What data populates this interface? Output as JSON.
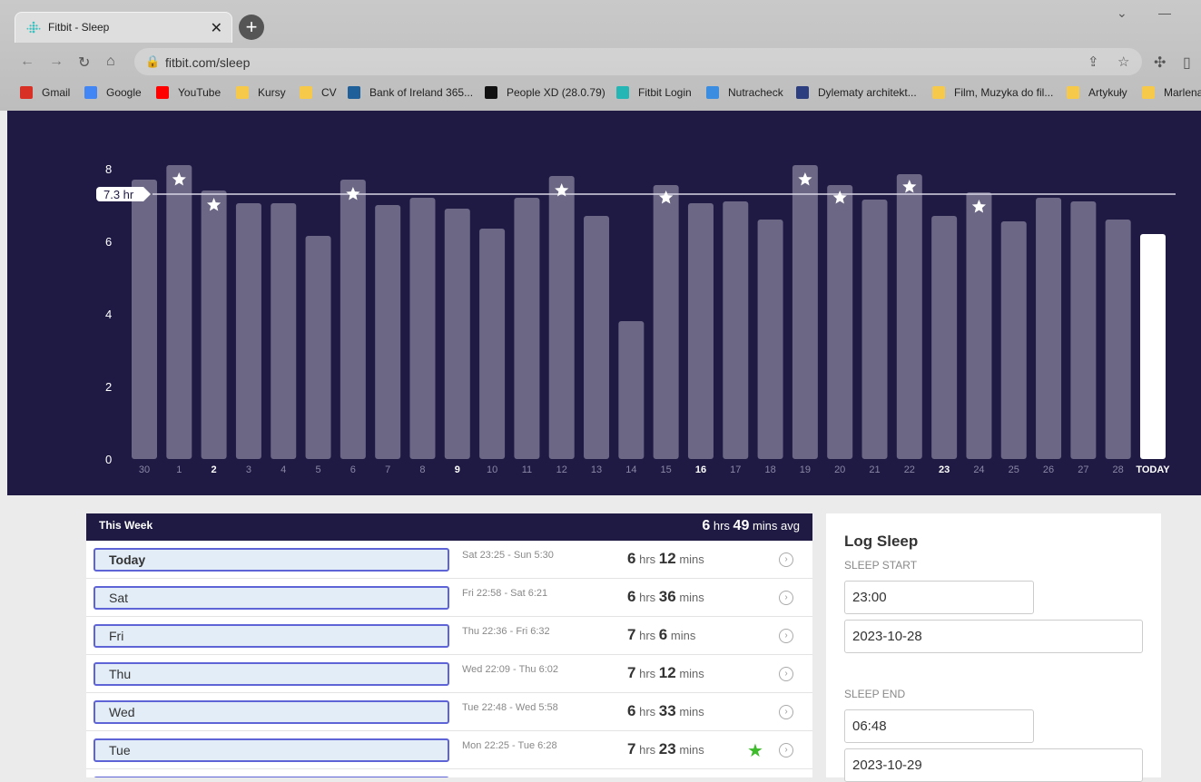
{
  "browser": {
    "tab_title": "Fitbit - Sleep",
    "url": "fitbit.com/sleep",
    "bookmarks": [
      {
        "label": "Gmail",
        "color": "#d93025"
      },
      {
        "label": "Google",
        "color": "#4285f4"
      },
      {
        "label": "YouTube",
        "color": "#ff0000"
      },
      {
        "label": "Kursy",
        "color": "#f6c94b"
      },
      {
        "label": "CV",
        "color": "#f6c94b"
      },
      {
        "label": "Bank of Ireland 365...",
        "color": "#1f5f9a"
      },
      {
        "label": "People XD (28.0.79)",
        "color": "#111111"
      },
      {
        "label": "Fitbit Login",
        "color": "#24b5b5"
      },
      {
        "label": "Nutracheck",
        "color": "#3a8de0"
      },
      {
        "label": "Dylematy architekt...",
        "color": "#2c3e80"
      },
      {
        "label": "Film, Muzyka do fil...",
        "color": "#f6c94b"
      },
      {
        "label": "Artykuły",
        "color": "#f6c94b"
      },
      {
        "label": "Marlena",
        "color": "#f6c94b"
      }
    ]
  },
  "chart_data": {
    "type": "bar",
    "ylim": [
      0,
      8.5
    ],
    "yticks": [
      "0",
      "2",
      "4",
      "6",
      "8"
    ],
    "average_label": "7.3 hr",
    "average_value": 7.3,
    "categories": [
      "30",
      "1",
      "2",
      "3",
      "4",
      "5",
      "6",
      "7",
      "8",
      "9",
      "10",
      "11",
      "12",
      "13",
      "14",
      "15",
      "16",
      "17",
      "18",
      "19",
      "20",
      "21",
      "22",
      "23",
      "24",
      "25",
      "26",
      "27",
      "28",
      "TODAY"
    ],
    "bold_categories": [
      "2",
      "9",
      "16",
      "23",
      "TODAY"
    ],
    "values": [
      7.7,
      8.1,
      7.4,
      7.05,
      7.05,
      6.15,
      7.7,
      7.0,
      7.2,
      6.9,
      6.35,
      7.2,
      7.8,
      6.7,
      3.8,
      7.55,
      7.05,
      7.1,
      6.6,
      8.1,
      7.55,
      7.15,
      7.85,
      6.7,
      7.35,
      6.55,
      7.2,
      7.1,
      6.6,
      6.2
    ],
    "star_values": [
      null,
      7.7,
      7.0,
      null,
      null,
      null,
      7.3,
      null,
      null,
      null,
      null,
      null,
      7.4,
      null,
      null,
      7.2,
      null,
      null,
      null,
      7.7,
      7.2,
      null,
      7.5,
      null,
      6.95,
      null,
      null,
      null,
      null,
      null
    ],
    "bar_color": "#6b6785",
    "today_color": "#ffffff"
  },
  "week": {
    "title": "This Week",
    "avg_hrs": "6",
    "avg_mins": "49",
    "hrs_unit": "hrs",
    "mins_unit": "mins avg",
    "rows": [
      {
        "day": "Today",
        "range": "Sat 23:25 - Sun 5:30",
        "hrs": "6",
        "mins": "12",
        "hrs_unit": "hrs",
        "mins_unit": "mins",
        "star": false
      },
      {
        "day": "Sat",
        "range": "Fri 22:58 - Sat 6:21",
        "hrs": "6",
        "mins": "36",
        "hrs_unit": "hrs",
        "mins_unit": "mins",
        "star": false
      },
      {
        "day": "Fri",
        "range": "Thu 22:36 - Fri 6:32",
        "hrs": "7",
        "mins": "6",
        "hrs_unit": "hrs",
        "mins_unit": "mins",
        "star": false
      },
      {
        "day": "Thu",
        "range": "Wed 22:09 - Thu 6:02",
        "hrs": "7",
        "mins": "12",
        "hrs_unit": "hrs",
        "mins_unit": "mins",
        "star": false
      },
      {
        "day": "Wed",
        "range": "Tue 22:48 - Wed 5:58",
        "hrs": "6",
        "mins": "33",
        "hrs_unit": "hrs",
        "mins_unit": "mins",
        "star": false
      },
      {
        "day": "Tue",
        "range": "Mon 22:25 - Tue 6:28",
        "hrs": "7",
        "mins": "23",
        "hrs_unit": "hrs",
        "mins_unit": "mins",
        "star": true
      }
    ]
  },
  "log_sleep": {
    "title": "Log Sleep",
    "start_label": "SLEEP START",
    "start_time": "23:00",
    "start_date": "2023-10-28",
    "end_label": "SLEEP END",
    "end_time": "06:48",
    "end_date": "2023-10-29"
  }
}
